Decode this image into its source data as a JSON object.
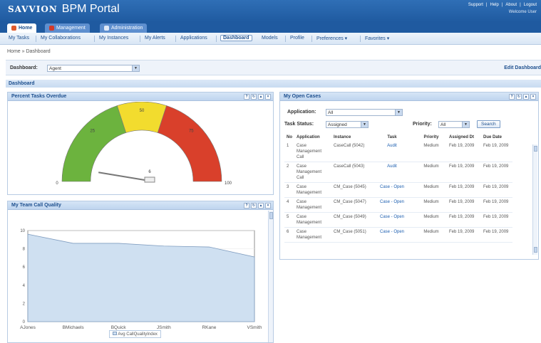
{
  "header": {
    "logo": "SAVVION",
    "product": "BPM Portal",
    "links": [
      "Support",
      "Help",
      "About",
      "Logout"
    ],
    "welcome": "Welcome User"
  },
  "tabs": [
    "Home",
    "Management",
    "Administration"
  ],
  "nav": [
    "My Tasks",
    "My Collaborations",
    "My Instances",
    "My Alerts",
    "Applications",
    "Dashboard",
    "Models",
    "Profile",
    "Preferences ▾",
    "Favorites ▾"
  ],
  "breadcrumb": "Home » Dashboard",
  "filter": {
    "label": "Dashboard:",
    "value": "Agent",
    "edit": "Edit Dashboard"
  },
  "section_title": "Dashboard",
  "overdue": {
    "title": "Percent Tasks Overdue",
    "ticks": [
      "0",
      "25",
      "50",
      "75",
      "100"
    ],
    "value_label": "6",
    "value": 6
  },
  "call_quality": {
    "title": "My Team Call Quality",
    "legend": "Avg CallQualityIndex"
  },
  "cases": {
    "title": "My Open Cases",
    "application_label": "Application:",
    "application_value": "All",
    "status_label": "Task Status:",
    "status_value": "Assigned",
    "priority_label": "Priority:",
    "priority_value": "All",
    "search": "Search",
    "columns": [
      "No",
      "Application",
      "Instance",
      "Task",
      "Priority",
      "Assigned Dt",
      "Due Date"
    ],
    "rows": [
      [
        "1",
        "Case Management Call",
        "CaseCall (5042)",
        "Audit",
        "Medium",
        "Feb 19, 2009",
        "Feb 19, 2009"
      ],
      [
        "2",
        "Case Management Call",
        "CaseCall (5043)",
        "Audit",
        "Medium",
        "Feb 19, 2009",
        "Feb 19, 2009"
      ],
      [
        "3",
        "Case Management",
        "CM_Case (5045)",
        "Case - Open",
        "Medium",
        "Feb 19, 2009",
        "Feb 19, 2009"
      ],
      [
        "4",
        "Case Management",
        "CM_Case (5047)",
        "Case - Open",
        "Medium",
        "Feb 19, 2009",
        "Feb 19, 2009"
      ],
      [
        "5",
        "Case Management",
        "CM_Case (5049)",
        "Case - Open",
        "Medium",
        "Feb 19, 2009",
        "Feb 19, 2009"
      ],
      [
        "6",
        "Case Management",
        "CM_Case (5051)",
        "Case - Open",
        "Medium",
        "Feb 19, 2009",
        "Feb 19, 2009"
      ]
    ]
  },
  "chart_data": [
    {
      "type": "gauge",
      "title": "Percent Tasks Overdue",
      "range": [
        0,
        100
      ],
      "ticks": [
        0,
        25,
        50,
        75,
        100
      ],
      "bands": [
        {
          "from": 0,
          "to": 40,
          "color": "#6cb33e"
        },
        {
          "from": 40,
          "to": 60,
          "color": "#f2dc2e"
        },
        {
          "from": 60,
          "to": 100,
          "color": "#d9402b"
        }
      ],
      "value": 6
    },
    {
      "type": "area",
      "title": "My Team Call Quality",
      "categories": [
        "AJones",
        "BMichaels",
        "BQuick",
        "JSmith",
        "RKane",
        "VSmith"
      ],
      "series": [
        {
          "name": "Avg CallQualityIndex",
          "values": [
            9.6,
            8.6,
            8.6,
            8.3,
            8.2,
            7.1
          ]
        }
      ],
      "ylim": [
        0,
        10
      ],
      "yticks": [
        "0",
        "2",
        "4",
        "6",
        "8",
        "10"
      ],
      "color": "#cfe0f1"
    }
  ]
}
